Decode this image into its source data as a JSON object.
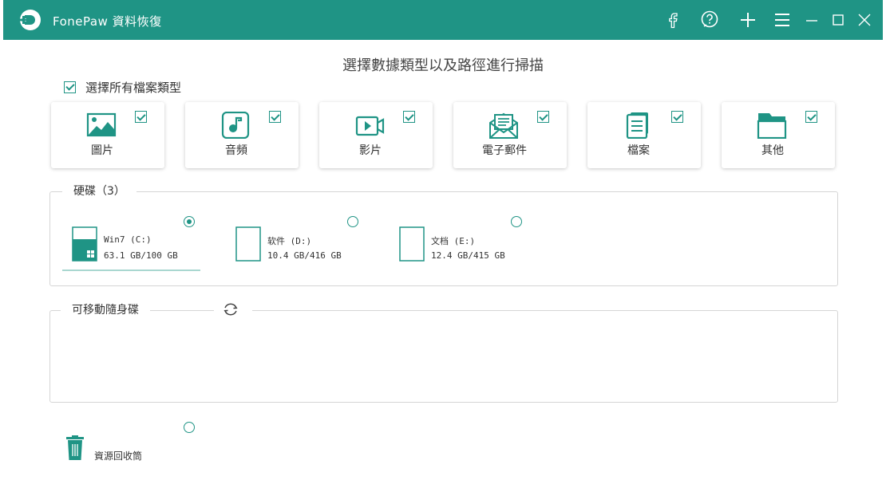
{
  "app": {
    "title": "FonePaw 資料恢復",
    "accent_color": "#1f9485"
  },
  "titlebar_buttons": [
    {
      "name": "facebook-icon"
    },
    {
      "name": "help-icon"
    },
    {
      "name": "plus-icon"
    },
    {
      "name": "menu-icon"
    },
    {
      "name": "minimize-icon"
    },
    {
      "name": "maximize-icon"
    },
    {
      "name": "close-icon"
    }
  ],
  "main": {
    "title": "選擇數據類型以及路徑進行掃描",
    "select_all_label": "選擇所有檔案類型",
    "select_all_checked": true
  },
  "file_types": [
    {
      "label": "圖片",
      "icon": "image-icon",
      "checked": true
    },
    {
      "label": "音頻",
      "icon": "music-icon",
      "checked": true
    },
    {
      "label": "影片",
      "icon": "video-icon",
      "checked": true
    },
    {
      "label": "電子郵件",
      "icon": "email-icon",
      "checked": true
    },
    {
      "label": "檔案",
      "icon": "document-icon",
      "checked": true
    },
    {
      "label": "其他",
      "icon": "folder-icon",
      "checked": true
    }
  ],
  "hard_drives": {
    "legend": "硬碟（3）",
    "drives": [
      {
        "name": "Win7 (C:)",
        "size": "63.1 GB/100 GB",
        "selected": true,
        "fill": 0.631
      },
      {
        "name": "软件 (D:)",
        "size": "10.4 GB/416 GB",
        "selected": false,
        "fill": 0.025
      },
      {
        "name": "文档 (E:)",
        "size": "12.4 GB/415 GB",
        "selected": false,
        "fill": 0.03
      }
    ]
  },
  "removable": {
    "legend": "可移動隨身碟",
    "refresh_icon": "refresh-icon"
  },
  "recycle_bin": {
    "label": "資源回收筒",
    "selected": false
  }
}
